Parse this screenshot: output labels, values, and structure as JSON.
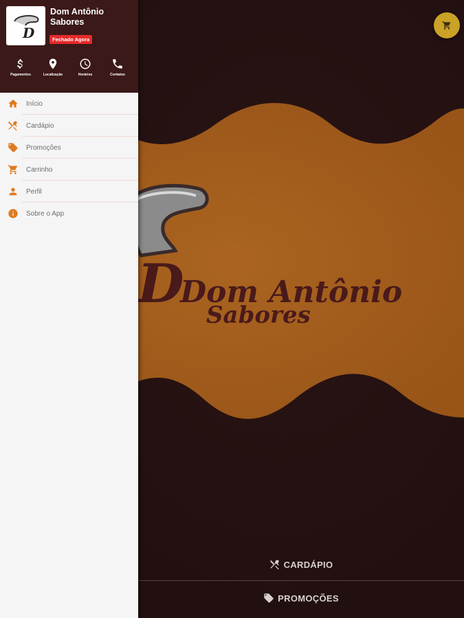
{
  "store": {
    "name": "Dom Antônio Sabores",
    "status_badge": "Fechado Agora",
    "logo_letter": "D"
  },
  "quick_actions": [
    {
      "label": "Pagamentos",
      "icon": "dollar-icon"
    },
    {
      "label": "Localização",
      "icon": "location-pin-icon"
    },
    {
      "label": "Horários",
      "icon": "clock-icon"
    },
    {
      "label": "Contatos",
      "icon": "phone-icon"
    }
  ],
  "menu": [
    {
      "label": "Início",
      "icon": "home-icon"
    },
    {
      "label": "Cardápio",
      "icon": "fork-knife-icon"
    },
    {
      "label": "Promoções",
      "icon": "tag-icon"
    },
    {
      "label": "Carrinho",
      "icon": "cart-icon"
    },
    {
      "label": "Perfil",
      "icon": "person-icon"
    },
    {
      "label": "Sobre o App",
      "icon": "info-icon"
    }
  ],
  "banner": {
    "title_line1": "Dom Antônio",
    "title_line2": "Sabores"
  },
  "bottom_nav": {
    "cardapio": "CARDÁPIO",
    "promocoes": "PROMOÇÕES"
  },
  "colors": {
    "accent": "#e07a1f",
    "header_bg": "#3b1919",
    "page_bg": "#221010",
    "banner": "#a35d1c",
    "badge": "#e52a2a",
    "cart_fab": "#c9a227"
  }
}
